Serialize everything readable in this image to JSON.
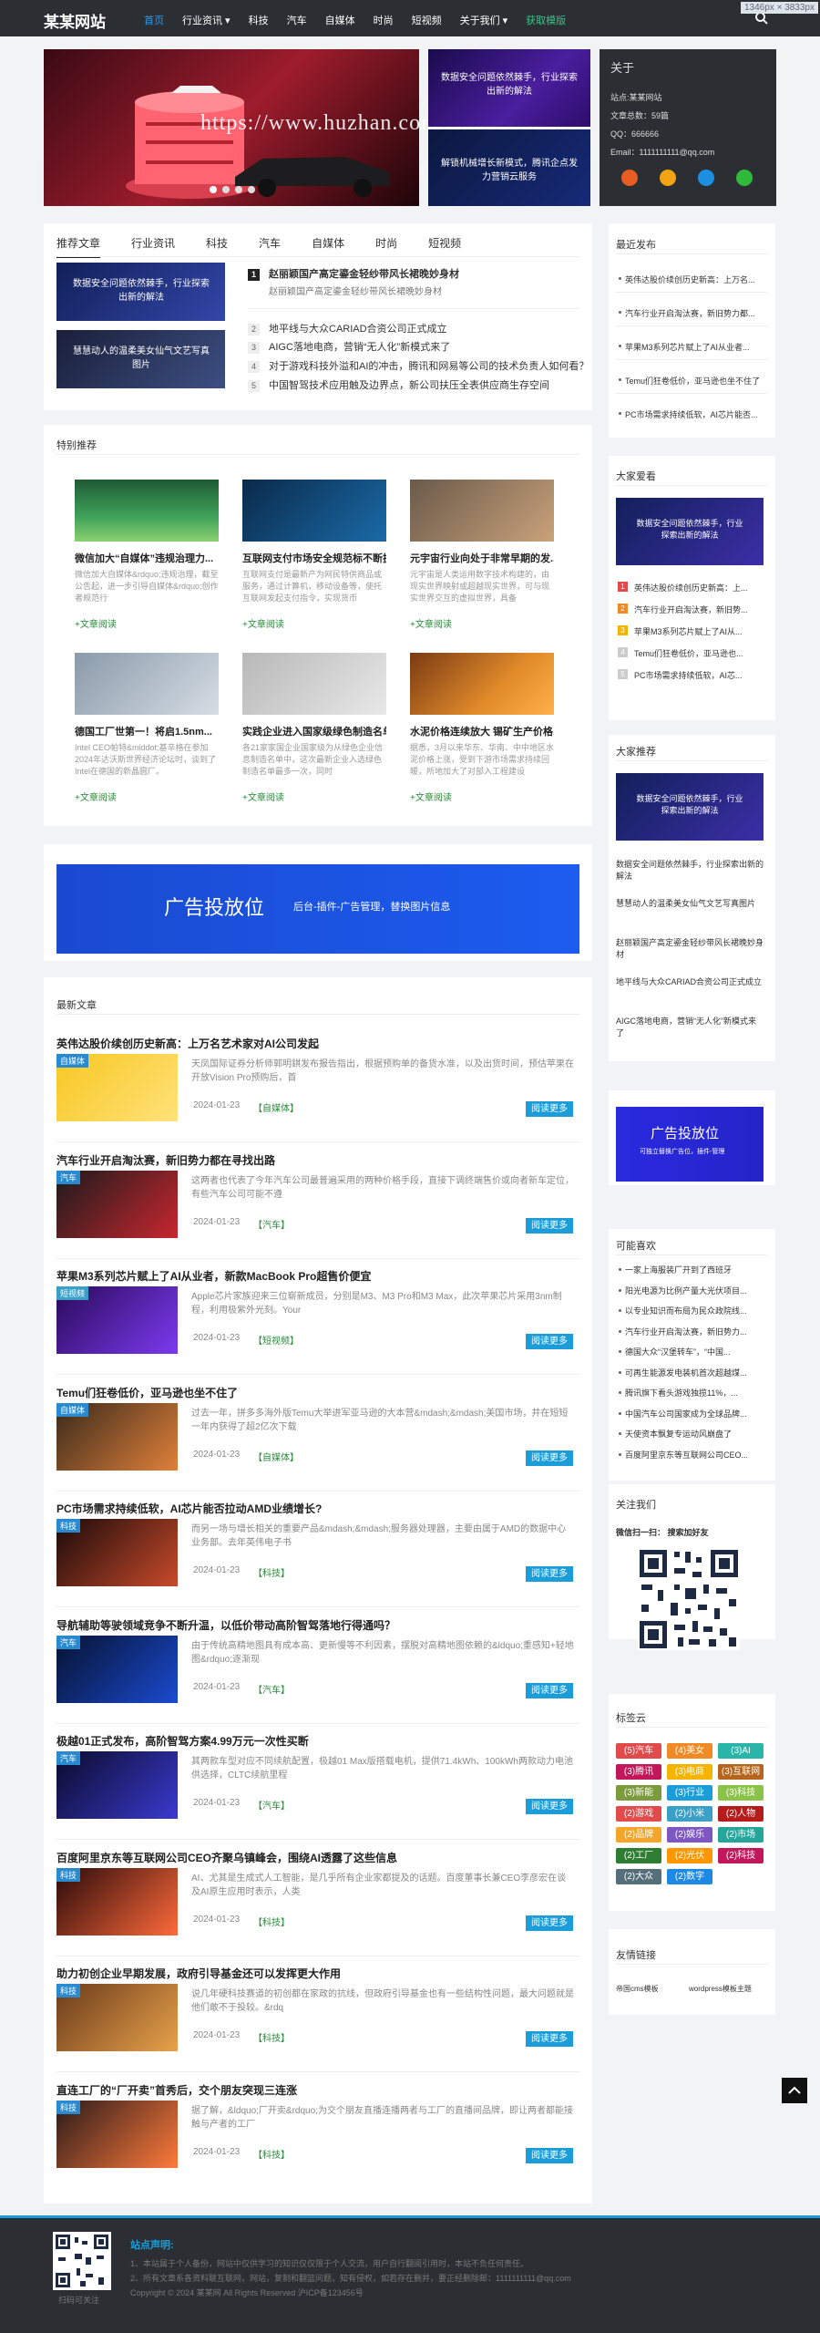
{
  "site": {
    "logo": "某某网站",
    "dims": "1346px × 3833px"
  },
  "nav": {
    "items": [
      "首页",
      "行业资讯 ▾",
      "科技",
      "汽车",
      "自媒体",
      "时尚",
      "短视频",
      "关于我们 ▾",
      "获取模版"
    ]
  },
  "slider": {
    "watermark": "https://www.huzhan.com/ishop23582"
  },
  "slide2": {
    "caption1": "数据安全问题依然棘手，行业探索出新的解法",
    "caption2": "解锁机械增长新模式，腾讯企点发力营销云服务"
  },
  "about": {
    "title": "关于",
    "lines": [
      "站点:某某网站",
      "文章总数：59篇",
      "QQ：666666",
      "Email：1111111111@qq.com"
    ]
  },
  "tabs": [
    "推荐文章",
    "行业资讯",
    "科技",
    "汽车",
    "自媒体",
    "时尚",
    "短视频"
  ],
  "tab_images": [
    {
      "caption": "数据安全问题依然棘手，行业探索出新的解法"
    },
    {
      "caption": "慧慧动人的温柔美女仙气文艺写真图片"
    }
  ],
  "headlines": [
    {
      "n": "1",
      "title": "赵丽颖国产高定鎏金轻纱带风长裙晚妙身材",
      "sub": "赵丽颖国产高定鎏金轻纱带风长裙晚妙身材"
    },
    {
      "n": "2",
      "title": "地平线与大众CARIAD合资公司正式成立"
    },
    {
      "n": "3",
      "title": "AIGC落地电商，营销“无人化”新模式来了"
    },
    {
      "n": "4",
      "title": "对于游戏科技外溢和AI的冲击，腾讯和网易等公司的技术负责人如何看？"
    },
    {
      "n": "5",
      "title": "中国智驾技术应用触及边界点，新公司扶压全表供应商生存空间"
    }
  ],
  "featured": {
    "title": "特别推荐",
    "items": [
      {
        "title": "微信加大“自媒体”违规治理力...",
        "desc": "微信加大自媒体&rdquo;违规治理，截至公告起，进一步引导自媒体&rdquo;创作者规范行",
        "link": "+文章阅读"
      },
      {
        "title": "互联网支付市场安全规范标不断扩大",
        "desc": "互联网支付是最新产为网民特供商品或服务，通过计算机，移动设备等，使托互联网发起支付指令，实现货币",
        "link": "+文章阅读"
      },
      {
        "title": "元宇宙行业向处于非常早期的发...",
        "desc": "元宇宙是人类运用数字技术构建的，由现实世界映射或超越现实世界，可与现实世界交互的虚拟世界，具备",
        "link": "+文章阅读"
      },
      {
        "title": "德国工厂世第一！将启1.5nm...",
        "desc": "Intel CEO帕特&middot;基辛格在参加2024年达沃斯世界经济论坛时，谈到了Intel在德国的新晶圆厂。",
        "link": "+文章阅读"
      },
      {
        "title": "实践企业进入国家级绿色制造名单",
        "desc": "各21家家国企业国家级为从绿色企业信息制造名单中，这次最新企业入选绿色制造名单最多一次，同时",
        "link": "+文章阅读"
      },
      {
        "title": "水泥价格连续放大 锡矿生产价格...",
        "desc": "据悉，3月以来华东、华南、中中地区水泥价格上涨，受到下游市场需求持续回暖，所地加大了对部入工程建设",
        "link": "+文章阅读"
      }
    ]
  },
  "ad": {
    "big": "广告投放位",
    "small": "后台-插件-广告管理，替换图片信息",
    "side_big": "广告投放位",
    "side_small": "可独立替换广告位，插件-管理"
  },
  "latest": {
    "title": "最新文章",
    "items": [
      {
        "title": "英伟达股价续创历史新高：上万名艺术家对AI公司发起",
        "badge": "自媒体",
        "desc": "天凤国际证券分析师郭明錤发布报告指出，根据预购单的备货水准，以及出货时间，预估苹果在开放Vision Pro预购后，首",
        "date": "2024-01-23",
        "tag": "【自媒体】",
        "btn": "阅读更多"
      },
      {
        "title": "汽车行业开启淘汰赛，新旧势力都在寻找出路",
        "badge": "汽车",
        "desc": "这两者也代表了今年汽车公司最普遍采用的两种价格手段，直接下调终端售价或向者新车定位，有些汽车公司可能不遵",
        "date": "2024-01-23",
        "tag": "【汽车】",
        "btn": "阅读更多"
      },
      {
        "title": "苹果M3系列芯片赋上了AI从业者，新款MacBook Pro超售价便宜",
        "badge": "短视频",
        "desc": "Apple芯片家族迎来三位崭新成员，分别是M3、M3 Pro和M3 Max，此次苹果芯片采用3nm制程，利用极紫外光刻。Your",
        "date": "2024-01-23",
        "tag": "【短视频】",
        "btn": "阅读更多"
      },
      {
        "title": "Temu们狂卷低价，亚马逊也坐不住了",
        "badge": "自媒体",
        "desc": "过去一年，拼多多海外版Temu大举进军亚马逊的大本营&mdash;&mdash;美国市场，并在短短一年内获得了超2亿次下载",
        "date": "2024-01-23",
        "tag": "【自媒体】",
        "btn": "阅读更多"
      },
      {
        "title": "PC市场需求持续低软，AI芯片能否拉动AMD业绩增长?",
        "badge": "科技",
        "desc": "而另一场与增长相关的重要产品&mdash;&mdash;服务器处理器，主要由属于AMD的数据中心业务部。去年英伟电子书",
        "date": "2024-01-23",
        "tag": "【科技】",
        "btn": "阅读更多"
      },
      {
        "title": "导航辅助等驶领域竞争不断升温，以低价带动高阶智驾落地行得通吗？",
        "badge": "汽车",
        "desc": "由于传统高精地图具有成本高、更新慢等不利因素，摆脱对高精地图依赖的&ldquo;重感知+轻地图&rdquo;逐渐现",
        "date": "2024-01-23",
        "tag": "【汽车】",
        "btn": "阅读更多"
      },
      {
        "title": "极越01正式发布，高阶智驾方案4.99万元一次性买断",
        "badge": "汽车",
        "desc": "其两款车型对应不同续航配置，极越01 Max版搭载电机，提供71.4kWh、100kWh两款动力电池供选择，CLTC续航里程",
        "date": "2024-01-23",
        "tag": "【汽车】",
        "btn": "阅读更多"
      },
      {
        "title": "百度阿里京东等互联网公司CEO齐聚乌镇峰会，围绕AI透露了这些信息",
        "badge": "科技",
        "desc": "AI、尤其是生成式人工智能，是几乎所有企业家都提及的话题。百度董事长兼CEO李彦宏在谈及AI原生应用时表示，人类",
        "date": "2024-01-23",
        "tag": "【科技】",
        "btn": "阅读更多"
      },
      {
        "title": "助力初创企业早期发展，政府引导基金还可以发挥更大作用",
        "badge": "科技",
        "desc": "说几年硬科技赛道的初创都在家政的抗线，但政府引导基金也有一些结构性问题，最大问题就是他们敢不于投较。&rdq",
        "date": "2024-01-23",
        "tag": "【科技】",
        "btn": "阅读更多"
      },
      {
        "title": "直连工厂的“厂开卖”首秀后，交个朋友突现三连涨",
        "badge": "科技",
        "desc": "据了解，&ldquo;厂开卖&rdquo;为交个朋友直播连播两者与工厂的直播间品牌，即让两者都能接触与产者的工厂",
        "date": "2024-01-23",
        "tag": "【科技】",
        "btn": "阅读更多"
      }
    ]
  },
  "recent": {
    "title": "最近发布",
    "items": [
      "英伟达股价续创历史新高：上万名...",
      "汽车行业开启淘汰赛，新旧势力都...",
      "苹果M3系列芯片赋上了AI从业者...",
      "Temu们狂卷低价，亚马逊也坐不住了",
      "PC市场需求持续低软，AI芯片能否..."
    ]
  },
  "hot": {
    "title": "大家爱看",
    "img_caption": "数据安全问题依然棘手，行业探索出新的解法",
    "items": [
      "英伟达股价续创历史新高：上...",
      "汽车行业开启淘汰赛，新旧势...",
      "苹果M3系列芯片赋上了AI从...",
      "Temu们狂卷低价，亚马逊也...",
      "PC市场需求持续低软，AI芯..."
    ],
    "nums": [
      "1",
      "2",
      "3",
      "4",
      "5"
    ]
  },
  "rec": {
    "title": "大家推荐",
    "img_caption": "数据安全问题依然棘手，行业探索出新的解法",
    "items": [
      "数据安全问题依然棘手，行业探索出新的解法",
      "慧慧动人的温柔美女仙气文艺写真图片",
      "赵丽颖国产高定鎏金轻纱带风长裙晚妙身材",
      "地平线与大众CARIAD合资公司正式成立",
      "AIGC落地电商，营销“无人化”新模式来了"
    ]
  },
  "maybe": {
    "title": "可能喜欢",
    "items": [
      "一家上海服装厂开到了西班牙",
      "阳光电源为比例产量大光伏项目...",
      "以专业知识而布局为民众政院线...",
      "汽车行业开启淘汰赛，新旧势力...",
      "德国大众“汉堡转车”，“中国...",
      "可再生能源发电装机首次超越煤...",
      "腾讯旗下看头游戏独揽11%，...",
      "中国汽车公司国家成为全球品牌...",
      "天使资本飘复专运动风崩盘了",
      "百度阿里京东等互联网公司CEO..."
    ]
  },
  "follow": {
    "title": "关注我们",
    "text": "微信扫一扫： 搜索加好友"
  },
  "tagcloud": {
    "title": "标签云",
    "tags": [
      {
        "t": "(5)汽车",
        "c": "#e14b4b"
      },
      {
        "t": "(4)美女",
        "c": "#f08a24"
      },
      {
        "t": "(3)AI",
        "c": "#29b6a8"
      },
      {
        "t": "(3)腾讯",
        "c": "#c2185b"
      },
      {
        "t": "(3)电商",
        "c": "#f4b400"
      },
      {
        "t": "(3)互联网",
        "c": "#b5651d"
      },
      {
        "t": "(3)新能",
        "c": "#7b9b3c"
      },
      {
        "t": "(3)行业",
        "c": "#1a9dd9"
      },
      {
        "t": "(3)科技",
        "c": "#8bc34a"
      },
      {
        "t": "(2)游戏",
        "c": "#e14b4b"
      },
      {
        "t": "(2)小米",
        "c": "#3aa0c8"
      },
      {
        "t": "(2)人物",
        "c": "#b71c1c"
      },
      {
        "t": "(2)品牌",
        "c": "#f4a62a"
      },
      {
        "t": "(2)娱乐",
        "c": "#7e57c2"
      },
      {
        "t": "(2)市场",
        "c": "#26a69a"
      },
      {
        "t": "(2)工厂",
        "c": "#2e7d32"
      },
      {
        "t": "(2)光伏",
        "c": "#ff9800"
      },
      {
        "t": "(2)科技",
        "c": "#c2185b"
      },
      {
        "t": "(2)大众",
        "c": "#546e7a"
      },
      {
        "t": "(2)数字",
        "c": "#1e88e5"
      }
    ]
  },
  "links": {
    "title": "友情链接",
    "items": [
      "帝国cms模板",
      "wordpress模板主题"
    ]
  },
  "footer": {
    "title": "站点声明:",
    "lines": [
      "1、本站属于个人备份，网站中仅供学习的知识仅仅限于个人交流，用户自行翻阅引用时，本站不负任何责任。",
      "2、所有文章系各资料联互联网，网站，复制和翻篮问题，知有侵权，如若存在删并，要正经删除邮：1111111111@qq.com",
      "Copyright © 2024 某某网 All Rights Reserved 沪ICP备123456号"
    ],
    "qr_caption": "扫码可关注"
  },
  "colors": {
    "accent": "#1a9dd9",
    "dark": "#2b2f33",
    "nav_active": "#2d9bf0",
    "nav_green": "#37c28a"
  }
}
